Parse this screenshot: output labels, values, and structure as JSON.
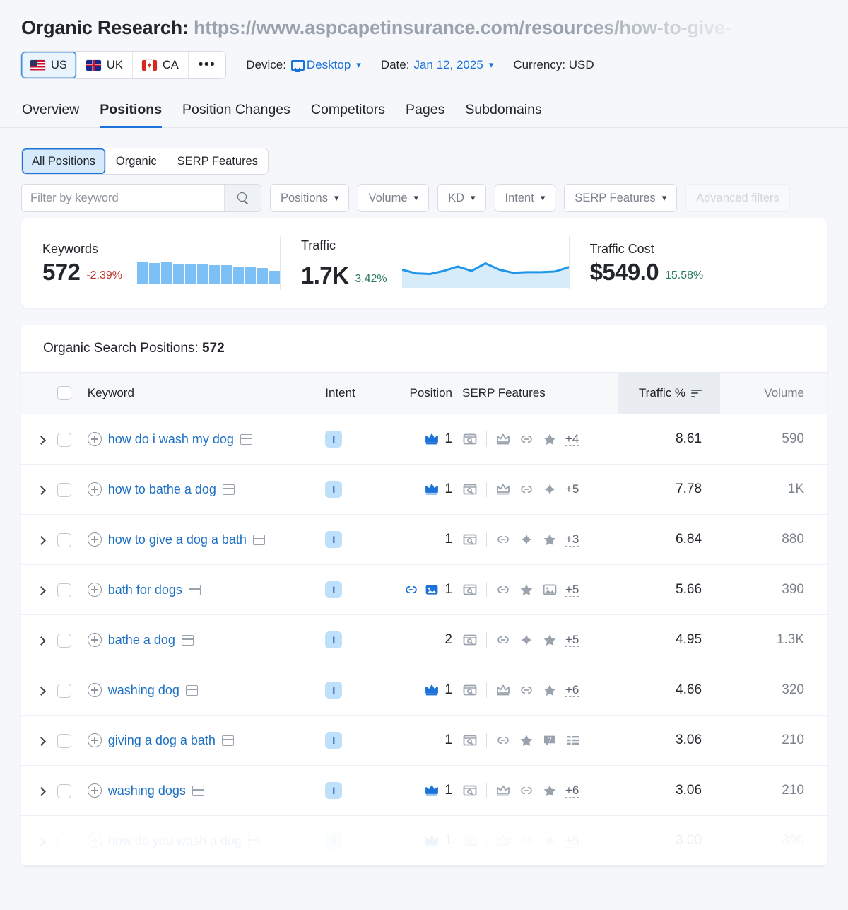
{
  "header": {
    "title_prefix": "Organic Research:",
    "url": "https://www.aspcapetinsurance.com/resources/how-to-give-",
    "geos": [
      {
        "label": "US",
        "flag": "flag-us-icon",
        "active": true
      },
      {
        "label": "UK",
        "flag": "flag-uk-icon",
        "active": false
      },
      {
        "label": "CA",
        "flag": "flag-ca-icon",
        "active": false
      }
    ],
    "more_label": "•••",
    "device_label": "Device:",
    "device_value": "Desktop",
    "date_label": "Date:",
    "date_value": "Jan 12, 2025",
    "currency_label": "Currency: USD"
  },
  "nav_tabs": [
    {
      "label": "Overview",
      "active": false
    },
    {
      "label": "Positions",
      "active": true
    },
    {
      "label": "Position Changes",
      "active": false
    },
    {
      "label": "Competitors",
      "active": false
    },
    {
      "label": "Pages",
      "active": false
    },
    {
      "label": "Subdomains",
      "active": false
    }
  ],
  "segmented": [
    {
      "label": "All Positions",
      "active": true
    },
    {
      "label": "Organic",
      "active": false
    },
    {
      "label": "SERP Features",
      "active": false
    }
  ],
  "filters": {
    "search_placeholder": "Filter by keyword",
    "search_value": "",
    "dropdowns": [
      {
        "label": "Positions"
      },
      {
        "label": "Volume"
      },
      {
        "label": "KD"
      },
      {
        "label": "Intent"
      },
      {
        "label": "SERP Features"
      },
      {
        "label": "Advanced filters"
      }
    ]
  },
  "metrics": [
    {
      "label": "Keywords",
      "value": "572",
      "delta": "-2.39%",
      "delta_dir": "neg",
      "viz": "bars"
    },
    {
      "label": "Traffic",
      "value": "1.7K",
      "delta": "3.42%",
      "delta_dir": "pos",
      "viz": "line"
    },
    {
      "label": "Traffic Cost",
      "value": "$549.0",
      "delta": "15.58%",
      "delta_dir": "pos",
      "viz": "none"
    }
  ],
  "chart_data": [
    {
      "type": "bar",
      "title": "Keywords",
      "categories": [
        "1",
        "2",
        "3",
        "4",
        "5",
        "6",
        "7",
        "8",
        "9",
        "10",
        "11",
        "12"
      ],
      "values": [
        31,
        29,
        30,
        27,
        27,
        28,
        26,
        26,
        23,
        23,
        22,
        18
      ],
      "ylim": [
        0,
        34
      ],
      "xlabel": "",
      "ylabel": ""
    },
    {
      "type": "area",
      "title": "Traffic",
      "x": [
        0,
        1,
        2,
        3,
        4,
        5,
        6,
        7,
        8,
        9,
        10,
        11,
        12
      ],
      "values": [
        20,
        14,
        13,
        18,
        25,
        18,
        30,
        20,
        15,
        16,
        16,
        17,
        24
      ],
      "ylim": [
        0,
        34
      ],
      "xlabel": "",
      "ylabel": ""
    }
  ],
  "table": {
    "title_prefix": "Organic Search Positions:",
    "title_count": "572",
    "columns": {
      "keyword": "Keyword",
      "intent": "Intent",
      "position": "Position",
      "serp_features": "SERP Features",
      "traffic_pct": "Traffic %",
      "volume": "Volume"
    },
    "sorted_by": "Traffic %",
    "rows": [
      {
        "keyword": "how do i wash my dog",
        "intent": "I",
        "pos_badge": "crown",
        "position": "1",
        "serp_icons": [
          "search-preview",
          "crown-outline",
          "link",
          "star"
        ],
        "serp_more": "+4",
        "traffic_pct": "8.61",
        "volume": "590"
      },
      {
        "keyword": "how to bathe a dog",
        "intent": "I",
        "pos_badge": "crown",
        "position": "1",
        "serp_icons": [
          "search-preview",
          "crown-outline",
          "link",
          "sparkle"
        ],
        "serp_more": "+5",
        "traffic_pct": "7.78",
        "volume": "1K"
      },
      {
        "keyword": "how to give a dog a bath",
        "intent": "I",
        "pos_badge": "",
        "position": "1",
        "serp_icons": [
          "search-preview",
          "link",
          "sparkle",
          "star"
        ],
        "serp_more": "+3",
        "traffic_pct": "6.84",
        "volume": "880"
      },
      {
        "keyword": "bath for dogs",
        "intent": "I",
        "pos_badge": "link-image",
        "position": "1",
        "serp_icons": [
          "search-preview",
          "link",
          "star",
          "image"
        ],
        "serp_more": "+5",
        "traffic_pct": "5.66",
        "volume": "390"
      },
      {
        "keyword": "bathe a dog",
        "intent": "I",
        "pos_badge": "",
        "position": "2",
        "serp_icons": [
          "search-preview",
          "link",
          "sparkle",
          "star"
        ],
        "serp_more": "+5",
        "traffic_pct": "4.95",
        "volume": "1.3K"
      },
      {
        "keyword": "washing dog",
        "intent": "I",
        "pos_badge": "crown",
        "position": "1",
        "serp_icons": [
          "search-preview",
          "crown-outline",
          "link",
          "star"
        ],
        "serp_more": "+6",
        "traffic_pct": "4.66",
        "volume": "320"
      },
      {
        "keyword": "giving a dog a bath",
        "intent": "I",
        "pos_badge": "",
        "position": "1",
        "serp_icons": [
          "search-preview",
          "link",
          "star",
          "faq",
          "list"
        ],
        "serp_more": "",
        "traffic_pct": "3.06",
        "volume": "210"
      },
      {
        "keyword": "washing dogs",
        "intent": "I",
        "pos_badge": "crown",
        "position": "1",
        "serp_icons": [
          "search-preview",
          "crown-outline",
          "link",
          "star"
        ],
        "serp_more": "+6",
        "traffic_pct": "3.06",
        "volume": "210"
      },
      {
        "keyword": "how do you wash a dog",
        "intent": "I",
        "pos_badge": "crown",
        "position": "1",
        "serp_icons": [
          "search-preview",
          "crown-outline",
          "link",
          "sparkle"
        ],
        "serp_more": "+5",
        "traffic_pct": "3.00",
        "volume": "390"
      }
    ]
  },
  "colors": {
    "accent": "#1b72d8",
    "link": "#1b6fc4",
    "bar": "#7dc0f5",
    "line": "#2196e8",
    "area": "#d7ecfb",
    "negative": "#c0392b",
    "positive": "#2a7a63",
    "intent_bg": "#bfe0fb",
    "intent_fg": "#1b5fa8"
  }
}
